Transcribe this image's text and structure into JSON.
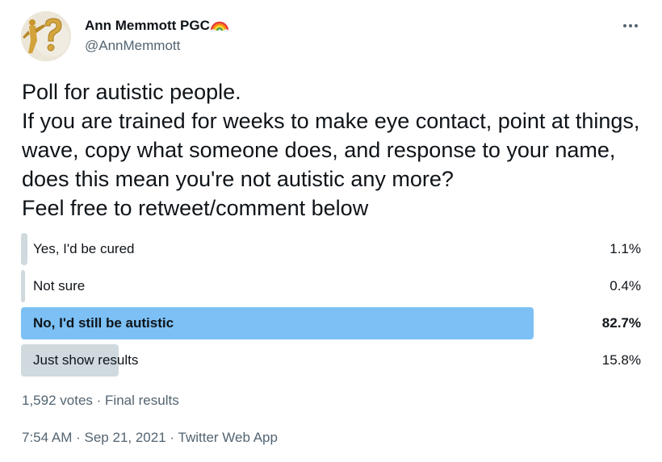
{
  "author": {
    "display_name": "Ann Memmott PGC",
    "name_emoji": "rainbow-icon",
    "handle": "@AnnMemmott",
    "avatar_icon": "question-mark-figure-icon"
  },
  "more_icon": "more-horizontal-icon",
  "tweet": {
    "text": "Poll for autistic people.\nIf you are trained for weeks to make eye contact, point at things, wave, copy what someone does, and response to your name, does this mean you're not autistic any more?\nFeel free to retweet/comment below"
  },
  "poll": {
    "options": [
      {
        "label": "Yes, I'd be cured",
        "percent": "1.1%",
        "share": 0.011,
        "winner": false
      },
      {
        "label": "Not sure",
        "percent": "0.4%",
        "share": 0.004,
        "winner": false
      },
      {
        "label": "No, I'd still be autistic",
        "percent": "82.7%",
        "share": 0.827,
        "winner": true
      },
      {
        "label": "Just show results",
        "percent": "15.8%",
        "share": 0.158,
        "winner": false
      }
    ],
    "votes": "1,592 votes",
    "separator": "·",
    "status": "Final results"
  },
  "meta": {
    "time": "7:54 AM",
    "separator1": "·",
    "date": "Sep 21, 2021",
    "separator2": "·",
    "source": "Twitter Web App"
  },
  "colors": {
    "winner_bar": "#7cc0f5",
    "other_bar": "#cfd9de",
    "secondary_text": "#536471"
  }
}
